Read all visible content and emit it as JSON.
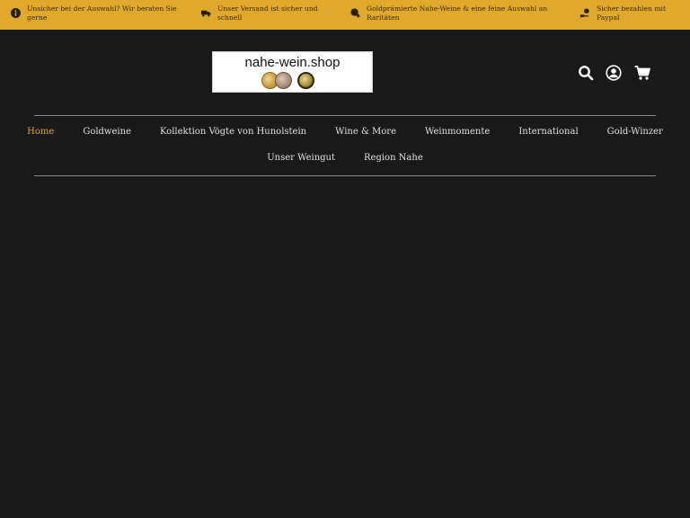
{
  "topbar": {
    "items": [
      {
        "icon": "info-icon",
        "text": "Unsicher bei der Auswahl? Wir beraten Sie gerne"
      },
      {
        "icon": "truck-icon",
        "text": "Unser Versand ist sicher und schnell"
      },
      {
        "icon": "medal-icon",
        "text": "Goldprämierte Nahe-Weine & eine feine Auswahl an Raritäten"
      },
      {
        "icon": "pay-hand-icon",
        "text": "Sicher bezahlen mit Paypal"
      }
    ]
  },
  "header": {
    "logo_text": "nahe-wein.shop",
    "icons": [
      "search-icon",
      "account-icon",
      "cart-icon"
    ]
  },
  "nav": {
    "items": [
      {
        "label": "Home",
        "active": true
      },
      {
        "label": "Goldweine"
      },
      {
        "label": "Kollektion Vögte von Hunolstein"
      },
      {
        "label": "Wine & More"
      },
      {
        "label": "Weinmomente"
      },
      {
        "label": "International"
      },
      {
        "label": "Gold-Winzer"
      },
      {
        "label": "Unser Weingut"
      },
      {
        "label": "Region Nahe"
      }
    ]
  },
  "colors": {
    "accent": "#e0a92c",
    "background": "#191919",
    "nav_text": "#e0e0e0"
  }
}
